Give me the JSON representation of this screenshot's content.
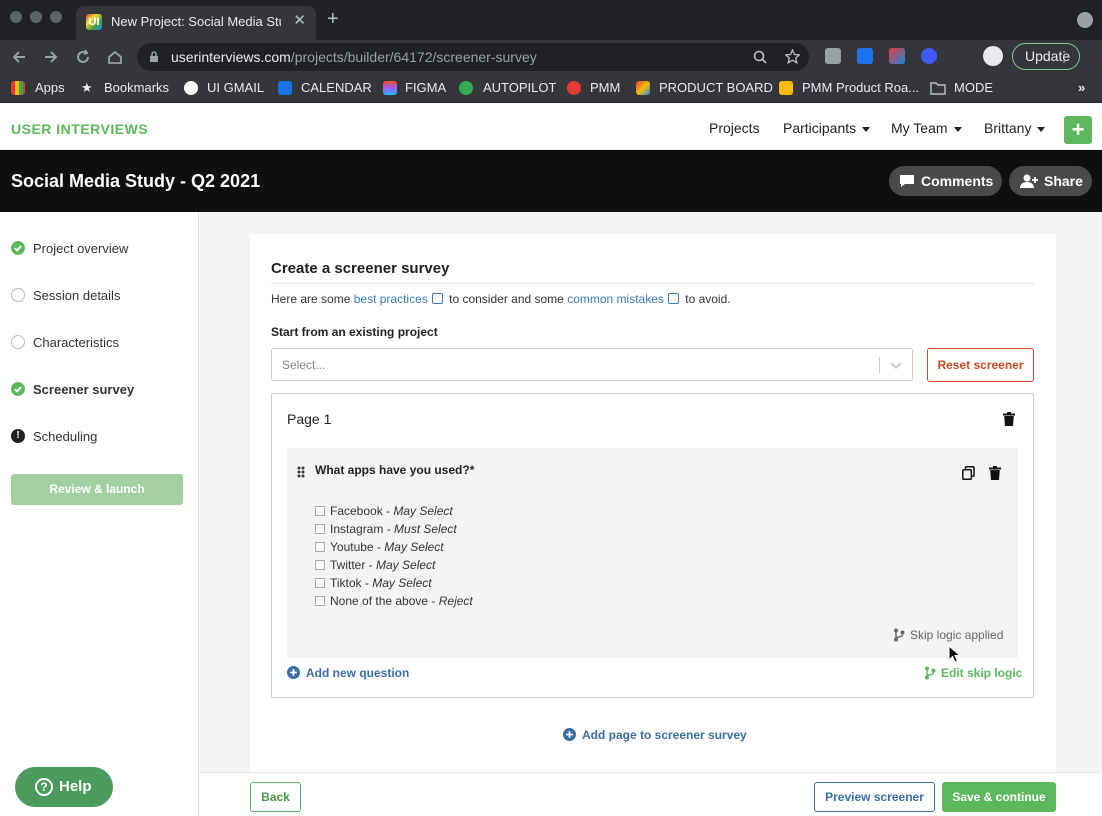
{
  "browser": {
    "tab_title": "New Project: Social Media Stud",
    "tab_favicon_text": "UI",
    "url_host": "userinterviews.com",
    "url_path": "/projects/builder/64172/screener-survey",
    "update_label": "Update",
    "bookmarks": [
      "Apps",
      "Bookmarks",
      "UI GMAIL",
      "CALENDAR",
      "FIGMA",
      "AUTOPILOT",
      "PMM",
      "PRODUCT BOARD",
      "PMM Product Roa...",
      "MODE"
    ]
  },
  "nav": {
    "brand": "USER INTERVIEWS",
    "links": [
      "Projects",
      "Participants",
      "My Team",
      "Brittany"
    ]
  },
  "header": {
    "title": "Social Media Study - Q2 2021",
    "comments_label": "Comments",
    "share_label": "Share"
  },
  "sidebar": {
    "steps": [
      {
        "label": "Project overview",
        "status": "complete"
      },
      {
        "label": "Session details",
        "status": "incomplete"
      },
      {
        "label": "Characteristics",
        "status": "incomplete"
      },
      {
        "label": "Screener survey",
        "status": "complete"
      },
      {
        "label": "Scheduling",
        "status": "warning"
      }
    ],
    "review_label": "Review & launch",
    "help_label": "Help"
  },
  "survey": {
    "title": "Create a screener survey",
    "intro_prefix": "Here are some",
    "intro_link1": "best practices",
    "intro_middle": "to consider and some",
    "intro_link2": "common mistakes",
    "intro_suffix": "to avoid.",
    "start_label": "Start from an existing project",
    "select_placeholder": "Select...",
    "reset_label": "Reset screener",
    "page_title": "Page 1",
    "question": "What apps have you used?*",
    "options": [
      {
        "label": "Facebook",
        "qualifier": "May Select"
      },
      {
        "label": "Instagram",
        "qualifier": "Must Select"
      },
      {
        "label": "Youtube",
        "qualifier": "May Select"
      },
      {
        "label": "Twitter",
        "qualifier": "May Select"
      },
      {
        "label": "Tiktok",
        "qualifier": "May Select"
      },
      {
        "label": "None of the above",
        "qualifier": "Reject"
      }
    ],
    "skip_applied": "Skip logic applied",
    "add_question": "Add new question",
    "edit_skip": "Edit skip logic",
    "add_page": "Add page to screener survey"
  },
  "footer": {
    "back_label": "Back",
    "preview_label": "Preview screener",
    "save_label": "Save & continue"
  },
  "colors": {
    "brand_green": "#5cb85c",
    "link_blue": "#3a7bb8",
    "danger": "#d04a26",
    "header_bg": "#0f0f0f"
  }
}
